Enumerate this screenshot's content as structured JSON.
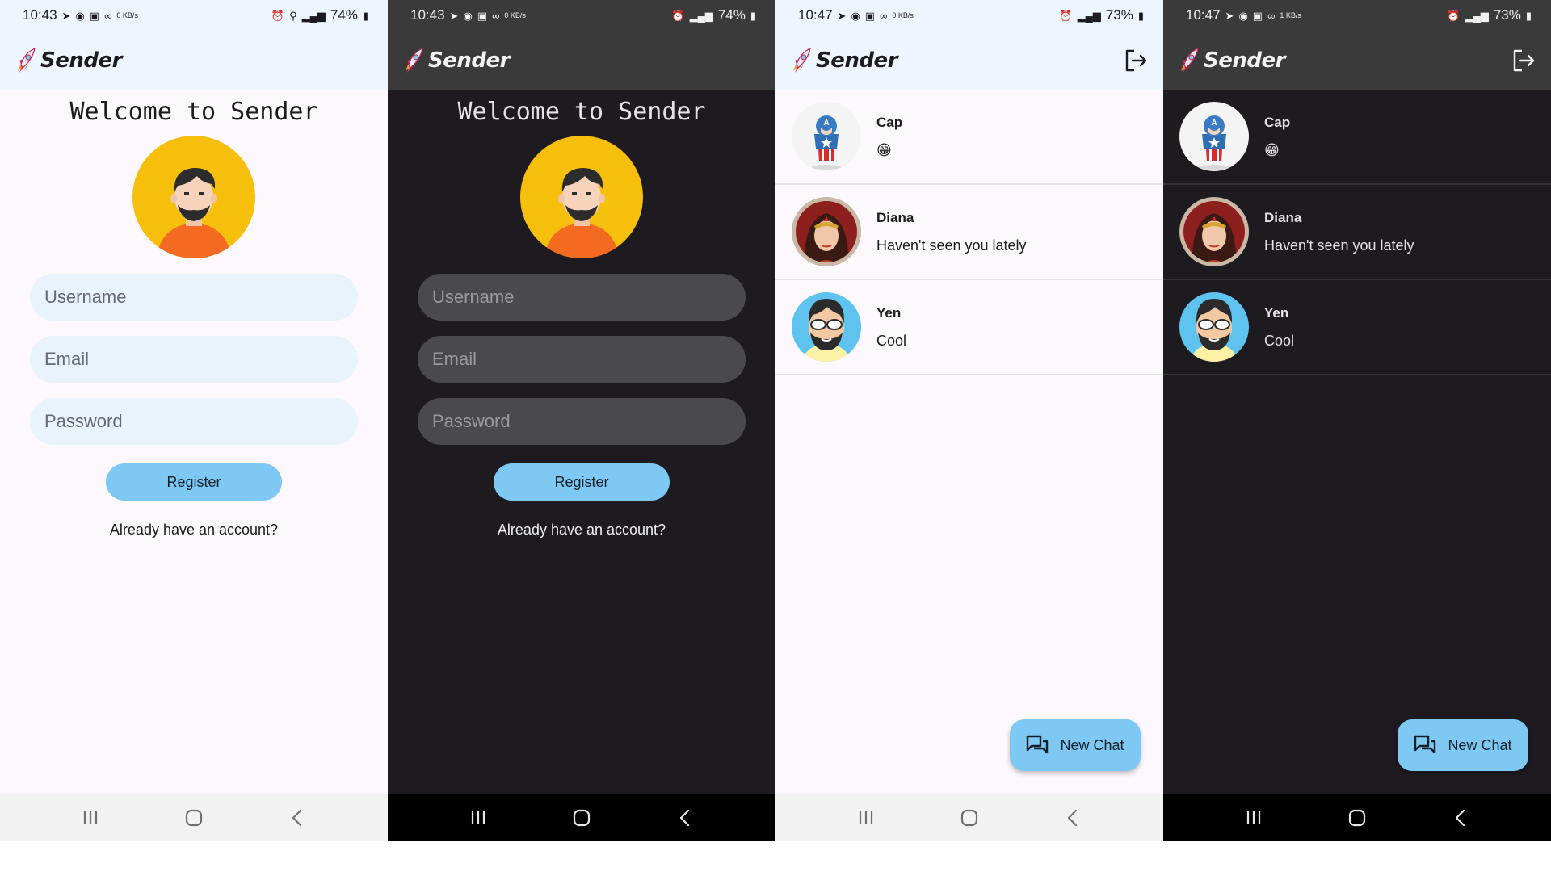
{
  "app": {
    "name": "Sender"
  },
  "colors": {
    "accent": "#7ec8f4",
    "light_bar": "#edf6fd",
    "dark_bar": "#3a3a3a",
    "dark_bg": "#1d1b20"
  },
  "screens": [
    {
      "theme": "light",
      "status": {
        "time": "10:43",
        "battery": "74%",
        "data_rate": "0 KB/s",
        "icons": [
          "telegram-icon",
          "whatsapp-icon",
          "gallery-icon",
          "infinity-icon",
          "alarm-icon",
          "location-icon",
          "signal-icon",
          "battery-icon"
        ]
      },
      "register": {
        "welcome": "Welcome to Sender",
        "username_placeholder": "Username",
        "email_placeholder": "Email",
        "password_placeholder": "Password",
        "register_label": "Register",
        "login_link": "Already have an account?"
      }
    },
    {
      "theme": "dark",
      "status": {
        "time": "10:43",
        "battery": "74%",
        "data_rate": "0 KB/s",
        "icons": [
          "telegram-icon",
          "whatsapp-icon",
          "gallery-icon",
          "infinity-icon",
          "alarm-icon",
          "signal-icon",
          "battery-icon"
        ]
      },
      "register": {
        "welcome": "Welcome to Sender",
        "username_placeholder": "Username",
        "email_placeholder": "Email",
        "password_placeholder": "Password",
        "register_label": "Register",
        "login_link": "Already have an account?"
      }
    },
    {
      "theme": "light",
      "status": {
        "time": "10:47",
        "battery": "73%",
        "data_rate": "0 KB/s",
        "icons": [
          "telegram-icon",
          "whatsapp-icon",
          "gallery-icon",
          "infinity-icon",
          "alarm-icon",
          "signal-icon",
          "battery-icon"
        ]
      },
      "chats": [
        {
          "name": "Cap",
          "message": "😁",
          "avatar": "captain-avatar"
        },
        {
          "name": "Diana",
          "message": "Haven't seen you lately",
          "avatar": "diana-avatar"
        },
        {
          "name": "Yen",
          "message": "Cool",
          "avatar": "yen-avatar"
        }
      ],
      "fab_label": "New Chat"
    },
    {
      "theme": "dark",
      "status": {
        "time": "10:47",
        "battery": "73%",
        "data_rate": "1 KB/s",
        "icons": [
          "telegram-icon",
          "whatsapp-icon",
          "gallery-icon",
          "infinity-icon",
          "alarm-icon",
          "signal-icon",
          "battery-icon"
        ]
      },
      "chats": [
        {
          "name": "Cap",
          "message": "😁",
          "avatar": "captain-avatar"
        },
        {
          "name": "Diana",
          "message": "Haven't seen you lately",
          "avatar": "diana-avatar"
        },
        {
          "name": "Yen",
          "message": "Cool",
          "avatar": "yen-avatar"
        }
      ],
      "fab_label": "New Chat"
    }
  ],
  "navbar": {
    "buttons": [
      "recent-apps",
      "home",
      "back"
    ]
  }
}
